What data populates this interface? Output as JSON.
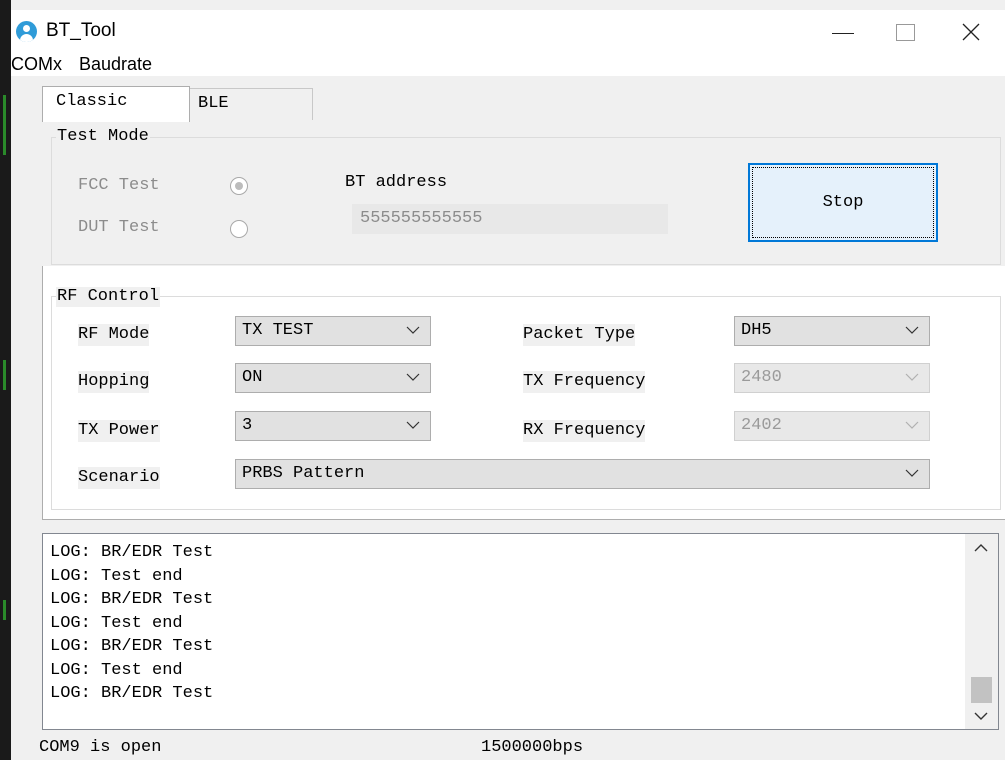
{
  "window": {
    "title": "BT_Tool"
  },
  "menu": {
    "items": [
      "COMx",
      "Baudrate"
    ]
  },
  "tabs": [
    {
      "label": "Classic",
      "active": true
    },
    {
      "label": "BLE",
      "active": false
    }
  ],
  "test_mode": {
    "title": "Test Mode",
    "fcc_label": "FCC Test",
    "fcc_selected": true,
    "dut_label": "DUT Test",
    "dut_selected": false,
    "address_label": "BT address",
    "address_value": "555555555555",
    "stop_label": "Stop"
  },
  "rf_control": {
    "title": "RF Control",
    "rf_mode_label": "RF Mode",
    "rf_mode_value": "TX TEST",
    "hopping_label": "Hopping",
    "hopping_value": "ON",
    "tx_power_label": "TX Power",
    "tx_power_value": "3",
    "packet_type_label": "Packet Type",
    "packet_type_value": "DH5",
    "tx_freq_label": "TX Frequency",
    "tx_freq_value": "2480",
    "rx_freq_label": "RX Frequency",
    "rx_freq_value": "2402",
    "scenario_label": "Scenario",
    "scenario_value": "PRBS Pattern"
  },
  "log": {
    "lines": [
      "LOG: BR/EDR Test",
      "LOG: Test end",
      "LOG: BR/EDR Test",
      "LOG: Test end",
      "LOG: BR/EDR Test",
      "LOG: Test end",
      "LOG: BR/EDR Test"
    ]
  },
  "status": {
    "port": "COM9 is open",
    "baud": "1500000bps"
  },
  "icons": {
    "app": "bluetooth-user-icon",
    "minimize": "minimize-icon",
    "maximize": "maximize-icon",
    "close": "close-icon",
    "chevron": "chevron-down-icon"
  },
  "colors": {
    "accent": "#0078d7",
    "app_icon": "#2f9bd8"
  }
}
